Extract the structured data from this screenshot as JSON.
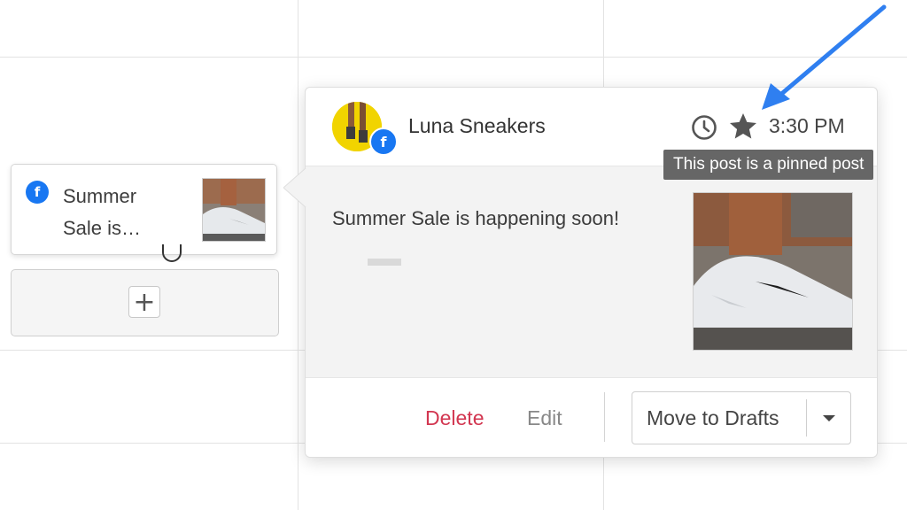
{
  "calendar": {
    "mini_post": {
      "text": "Summer Sale is…",
      "network_icon": "facebook-icon"
    },
    "add_button_label": "+"
  },
  "popover": {
    "account_name": "Luna Sneakers",
    "network_icon": "facebook-icon",
    "status_icons": [
      "clock-icon",
      "star-icon"
    ],
    "time": "3:30 PM",
    "post_text": "Summer Sale is happening soon!",
    "actions": {
      "delete_label": "Delete",
      "edit_label": "Edit",
      "move_label": "Move to Drafts"
    }
  },
  "tooltip": {
    "text": "This post is a pinned post"
  },
  "colors": {
    "facebook": "#1877f2",
    "delete": "#d23650",
    "annotation_arrow": "#2f7ff0",
    "tooltip_bg": "#666666",
    "avatar_bg": "#f1d400"
  }
}
